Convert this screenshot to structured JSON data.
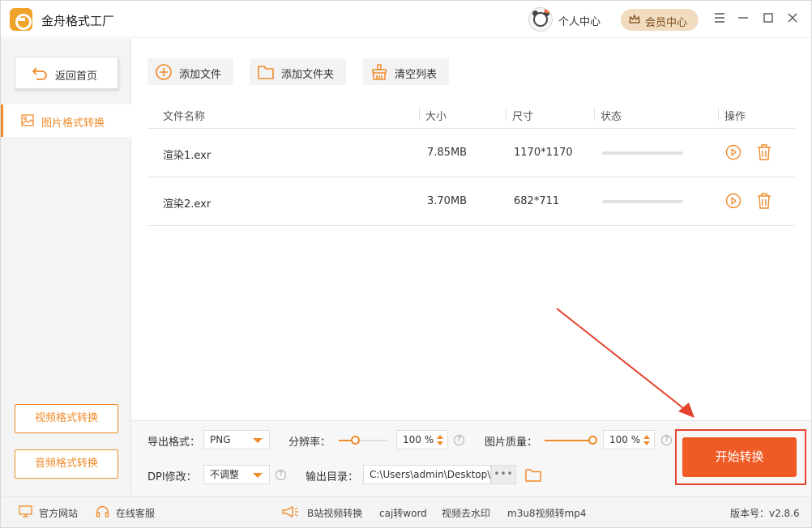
{
  "app": {
    "title": "金舟格式工厂"
  },
  "titlebar": {
    "user_center": "个人中心",
    "vip_center": "会员中心"
  },
  "sidebar": {
    "back_home": "返回首页",
    "active_item": "图片格式转换",
    "video_convert": "视频格式转换",
    "audio_convert": "音频格式转换"
  },
  "toolbar": {
    "add_file": "添加文件",
    "add_folder": "添加文件夹",
    "clear_list": "清空列表"
  },
  "table": {
    "headers": {
      "name": "文件名称",
      "size": "大小",
      "dimension": "尺寸",
      "status": "状态",
      "action": "操作"
    },
    "rows": [
      {
        "name": "渲染1.exr",
        "size": "7.85MB",
        "dimension": "1170*1170",
        "progress": 0
      },
      {
        "name": "渲染2.exr",
        "size": "3.70MB",
        "dimension": "682*711",
        "progress": 0
      }
    ]
  },
  "settings": {
    "export_format_label": "导出格式：",
    "export_format_value": "PNG",
    "resolution_label": "分辨率：",
    "resolution_value": "100 %",
    "resolution_level": 0.35,
    "quality_label": "图片质量：",
    "quality_value": "100 %",
    "quality_level": 1.0,
    "dpi_label": "DPI修改：",
    "dpi_value": "不调整",
    "output_dir_label": "输出目录：",
    "output_dir_value": "C:\\Users\\admin\\Desktop\\",
    "more": "•••",
    "help": "?"
  },
  "start_button": "开始转换",
  "footer": {
    "official_site": "官方网站",
    "online_service": "在线客服",
    "bilibili_convert": "B站视频转换",
    "caj_word": "caj转word",
    "video_watermark": "视频去水印",
    "m3u8_mp4": "m3u8视频转mp4",
    "version": "版本号：v2.8.6"
  },
  "colors": {
    "accent": "#f08b2a",
    "start": "#f05a24",
    "highlight": "#e5432e"
  }
}
